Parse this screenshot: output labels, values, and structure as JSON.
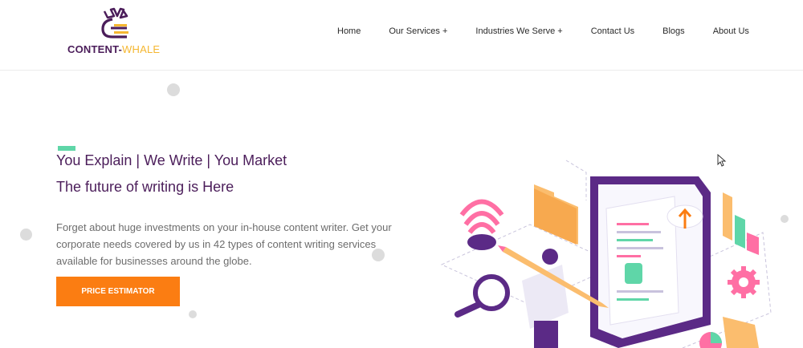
{
  "brand": {
    "name_part1": "CONTENT-",
    "name_part2": "WHALE"
  },
  "nav": {
    "home": "Home",
    "services": "Our Services +",
    "industries": "Industries We Serve +",
    "contact": "Contact Us",
    "blogs": "Blogs",
    "about": "About Us"
  },
  "hero": {
    "headline": "You Explain | We Write | You Market",
    "subheadline": "The future of writing is Here",
    "description": "Forget about huge investments on your in-house content writer. Get your corporate needs covered by us in 42 types of content writing services available for businesses around the globe.",
    "cta_label": "PRICE ESTIMATOR"
  },
  "colors": {
    "brand_purple": "#4b1d5a",
    "brand_yellow": "#f5b731",
    "accent_green": "#5fd6a8",
    "cta_orange": "#fb7d12"
  },
  "illustration": {
    "icons": [
      "wifi-icon",
      "folder-icon",
      "magnifier-icon",
      "gear-icon",
      "chart-icon",
      "pencil-icon",
      "document-icon",
      "upload-cloud-icon"
    ]
  }
}
